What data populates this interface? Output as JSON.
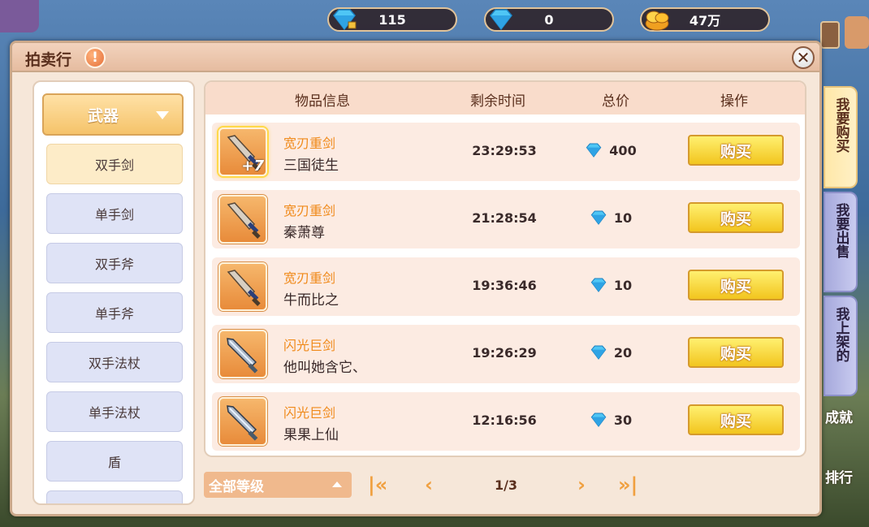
{
  "currency": {
    "bound_diamond": "115",
    "diamond": "0",
    "gold": "47万"
  },
  "window": {
    "title": "拍卖行",
    "warn_symbol": "!",
    "close_symbol": "✕"
  },
  "categories": {
    "dropdown_label": "武器",
    "items": [
      "双手剑",
      "单手剑",
      "双手斧",
      "单手斧",
      "双手法杖",
      "单手法杖",
      "盾"
    ],
    "active_index": 0
  },
  "list": {
    "headers": {
      "info": "物品信息",
      "time": "剩余时间",
      "price": "总价",
      "action": "操作"
    },
    "rows": [
      {
        "name": "宽刃重剑",
        "seller": "三国徒生",
        "time": "23:29:53",
        "price": "400",
        "enhance": "+7",
        "button": "购买",
        "icon": "broadsword-icon"
      },
      {
        "name": "宽刃重剑",
        "seller": "秦萧尊",
        "time": "21:28:54",
        "price": "10",
        "button": "购买",
        "icon": "broadsword-icon"
      },
      {
        "name": "宽刃重剑",
        "seller": "牛而比之",
        "time": "19:36:46",
        "price": "10",
        "button": "购买",
        "icon": "broadsword-icon"
      },
      {
        "name": "闪光巨剑",
        "seller": "他叫她含它、",
        "time": "19:26:29",
        "price": "20",
        "button": "购买",
        "icon": "greatsword-icon"
      },
      {
        "name": "闪光巨剑",
        "seller": "果果上仙",
        "time": "12:16:56",
        "price": "30",
        "button": "购买",
        "icon": "greatsword-icon"
      }
    ]
  },
  "pagination": {
    "level_filter": "全部等级",
    "page": "1/3"
  },
  "side_tabs": [
    "我要购买",
    "我要出售",
    "我上架的"
  ],
  "background_labels": [
    "成就",
    "排行"
  ],
  "colors": {
    "accent_orange": "#f08a1a",
    "buy_button": "#f2c51e",
    "tab_inactive": "#a6a9dc",
    "tab_active": "#ffe8a8"
  }
}
